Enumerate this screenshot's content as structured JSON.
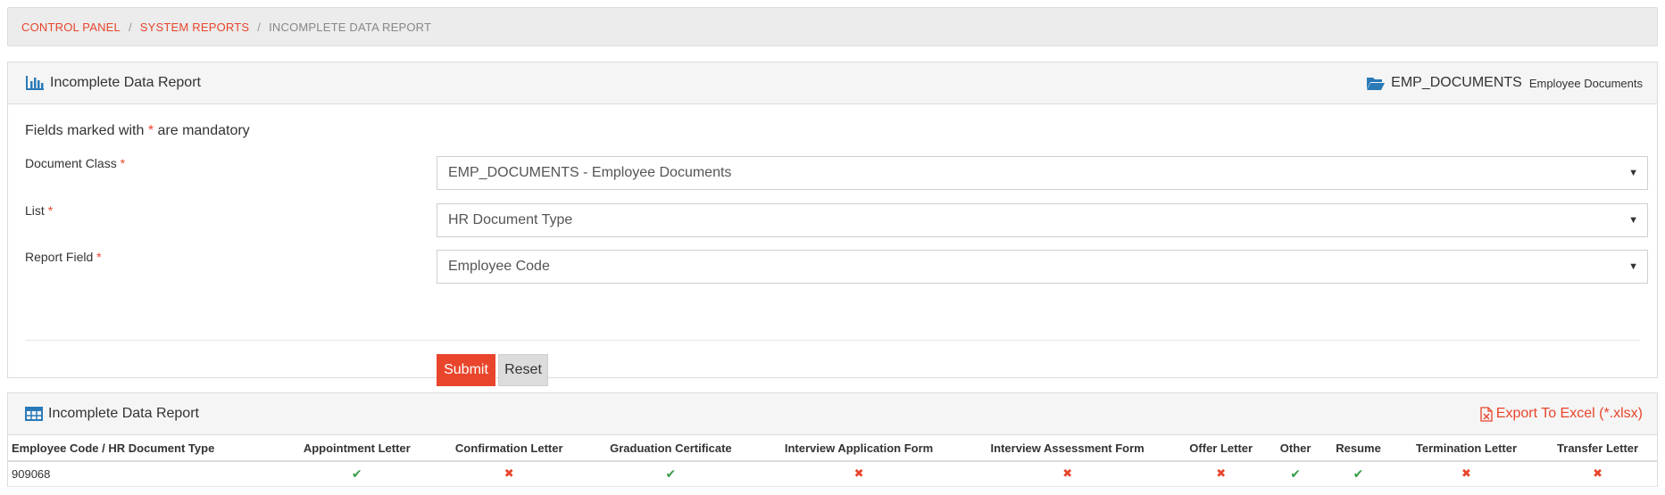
{
  "breadcrumb": {
    "items": [
      "CONTROL PANEL",
      "SYSTEM REPORTS"
    ],
    "current": "INCOMPLETE DATA REPORT",
    "separator": "/"
  },
  "form_panel": {
    "title": "Incomplete Data Report",
    "doc_class_code": "EMP_DOCUMENTS",
    "doc_class_desc": "Employee Documents",
    "mandatory_prefix": "Fields marked with ",
    "mandatory_star": "*",
    "mandatory_suffix": " are mandatory",
    "fields": [
      {
        "label": "Document Class",
        "value": "EMP_DOCUMENTS - Employee Documents"
      },
      {
        "label": "List",
        "value": "HR Document Type"
      },
      {
        "label": "Report Field",
        "value": "Employee Code"
      }
    ],
    "submit_label": "Submit",
    "reset_label": "Reset"
  },
  "report_panel": {
    "title": "Incomplete Data Report",
    "export_label": "Export To Excel (*.xlsx)",
    "columns": [
      "Employee Code / HR Document Type",
      "Appointment Letter",
      "Confirmation Letter",
      "Graduation Certificate",
      "Interview Application Form",
      "Interview Assessment Form",
      "Offer Letter",
      "Other",
      "Resume",
      "Termination Letter",
      "Transfer Letter"
    ],
    "rows": [
      {
        "code": "909068",
        "status": [
          true,
          false,
          true,
          false,
          false,
          false,
          true,
          true,
          false,
          false
        ]
      }
    ]
  },
  "colors": {
    "accent": "#e8452c",
    "icon_blue": "#2a7ab8",
    "check_green": "#3a9d4a"
  },
  "icons": {
    "check": "✔",
    "cross": "✖",
    "caret": "▼"
  }
}
